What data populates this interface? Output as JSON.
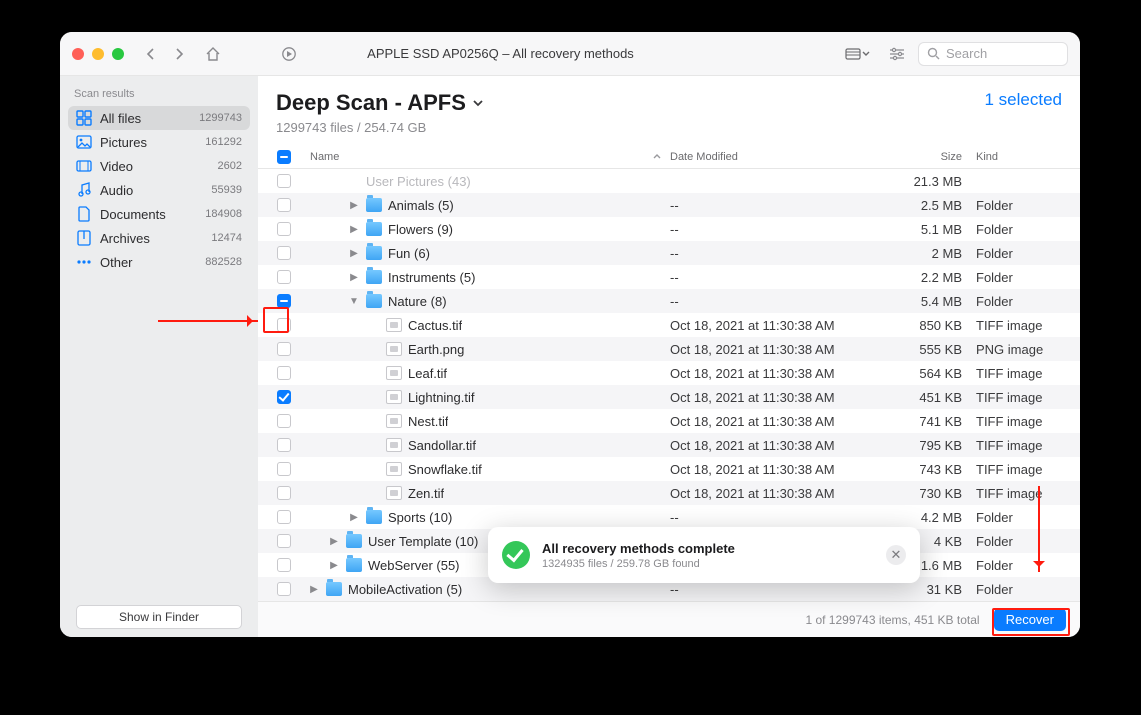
{
  "window": {
    "title": "APPLE SSD AP0256Q – All recovery methods"
  },
  "search": {
    "placeholder": "Search"
  },
  "sidebar": {
    "header": "Scan results",
    "items": [
      {
        "label": "All files",
        "count": "1299743",
        "icon": "grid-icon",
        "active": true
      },
      {
        "label": "Pictures",
        "count": "161292",
        "icon": "pictures-icon",
        "active": false
      },
      {
        "label": "Video",
        "count": "2602",
        "icon": "video-icon",
        "active": false
      },
      {
        "label": "Audio",
        "count": "55939",
        "icon": "audio-icon",
        "active": false
      },
      {
        "label": "Documents",
        "count": "184908",
        "icon": "documents-icon",
        "active": false
      },
      {
        "label": "Archives",
        "count": "12474",
        "icon": "archives-icon",
        "active": false
      },
      {
        "label": "Other",
        "count": "882528",
        "icon": "other-icon",
        "active": false
      }
    ],
    "show_in_finder": "Show in Finder"
  },
  "header": {
    "title": "Deep Scan - APFS",
    "subtitle": "1299743 files / 254.74 GB",
    "selected": "1 selected"
  },
  "columns": {
    "name": "Name",
    "date": "Date Modified",
    "size": "Size",
    "kind": "Kind"
  },
  "rows": [
    {
      "indent": 2,
      "chk": "off",
      "disclosure": "",
      "icon": "ghost",
      "name": "User Pictures (43)",
      "date": "",
      "size": "21.3 MB",
      "kind": "",
      "ghost": true
    },
    {
      "indent": 2,
      "chk": "off",
      "disclosure": ">",
      "icon": "folder",
      "name": "Animals (5)",
      "date": "--",
      "size": "2.5 MB",
      "kind": "Folder"
    },
    {
      "indent": 2,
      "chk": "off",
      "disclosure": ">",
      "icon": "folder",
      "name": "Flowers (9)",
      "date": "--",
      "size": "5.1 MB",
      "kind": "Folder"
    },
    {
      "indent": 2,
      "chk": "off",
      "disclosure": ">",
      "icon": "folder",
      "name": "Fun (6)",
      "date": "--",
      "size": "2 MB",
      "kind": "Folder"
    },
    {
      "indent": 2,
      "chk": "off",
      "disclosure": ">",
      "icon": "folder",
      "name": "Instruments (5)",
      "date": "--",
      "size": "2.2 MB",
      "kind": "Folder"
    },
    {
      "indent": 2,
      "chk": "indet",
      "disclosure": "v",
      "icon": "folder",
      "name": "Nature (8)",
      "date": "--",
      "size": "5.4 MB",
      "kind": "Folder"
    },
    {
      "indent": 3,
      "chk": "off",
      "disclosure": "",
      "icon": "tif",
      "name": "Cactus.tif",
      "date": "Oct 18, 2021 at 11:30:38 AM",
      "size": "850 KB",
      "kind": "TIFF image"
    },
    {
      "indent": 3,
      "chk": "off",
      "disclosure": "",
      "icon": "tif",
      "name": "Earth.png",
      "date": "Oct 18, 2021 at 11:30:38 AM",
      "size": "555 KB",
      "kind": "PNG image"
    },
    {
      "indent": 3,
      "chk": "off",
      "disclosure": "",
      "icon": "tif",
      "name": "Leaf.tif",
      "date": "Oct 18, 2021 at 11:30:38 AM",
      "size": "564 KB",
      "kind": "TIFF image"
    },
    {
      "indent": 3,
      "chk": "on",
      "disclosure": "",
      "icon": "tif",
      "name": "Lightning.tif",
      "date": "Oct 18, 2021 at 11:30:38 AM",
      "size": "451 KB",
      "kind": "TIFF image"
    },
    {
      "indent": 3,
      "chk": "off",
      "disclosure": "",
      "icon": "tif",
      "name": "Nest.tif",
      "date": "Oct 18, 2021 at 11:30:38 AM",
      "size": "741 KB",
      "kind": "TIFF image"
    },
    {
      "indent": 3,
      "chk": "off",
      "disclosure": "",
      "icon": "tif",
      "name": "Sandollar.tif",
      "date": "Oct 18, 2021 at 11:30:38 AM",
      "size": "795 KB",
      "kind": "TIFF image"
    },
    {
      "indent": 3,
      "chk": "off",
      "disclosure": "",
      "icon": "tif",
      "name": "Snowflake.tif",
      "date": "Oct 18, 2021 at 11:30:38 AM",
      "size": "743 KB",
      "kind": "TIFF image"
    },
    {
      "indent": 3,
      "chk": "off",
      "disclosure": "",
      "icon": "tif",
      "name": "Zen.tif",
      "date": "Oct 18, 2021 at 11:30:38 AM",
      "size": "730 KB",
      "kind": "TIFF image"
    },
    {
      "indent": 2,
      "chk": "off",
      "disclosure": ">",
      "icon": "folder",
      "name": "Sports (10)",
      "date": "--",
      "size": "4.2 MB",
      "kind": "Folder"
    },
    {
      "indent": 1,
      "chk": "off",
      "disclosure": ">",
      "icon": "folder",
      "name": "User Template (10)",
      "date": "",
      "size": "4 KB",
      "kind": "Folder"
    },
    {
      "indent": 1,
      "chk": "off",
      "disclosure": ">",
      "icon": "folder",
      "name": "WebServer (55)",
      "date": "--",
      "size": "1.6 MB",
      "kind": "Folder"
    },
    {
      "indent": 0,
      "chk": "off",
      "disclosure": ">",
      "icon": "folder",
      "name": "MobileActivation (5)",
      "date": "--",
      "size": "31 KB",
      "kind": "Folder"
    }
  ],
  "toast": {
    "title": "All recovery methods complete",
    "subtitle": "1324935 files / 259.78 GB found"
  },
  "footer": {
    "summary": "1 of 1299743 items, 451 KB total",
    "recover": "Recover"
  },
  "list_checkbox": "indet"
}
